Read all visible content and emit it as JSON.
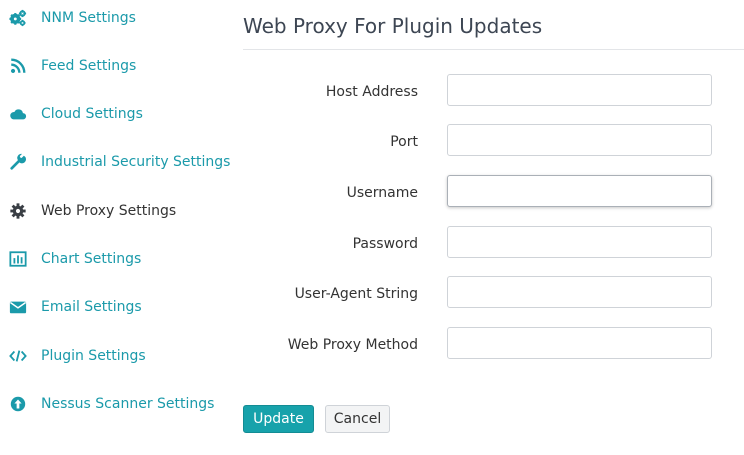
{
  "sidebar": {
    "items": [
      {
        "label": "NNM Settings",
        "icon": "gears-icon"
      },
      {
        "label": "Feed Settings",
        "icon": "rss-icon"
      },
      {
        "label": "Cloud Settings",
        "icon": "cloud-icon"
      },
      {
        "label": "Industrial Security Settings",
        "icon": "wrench-icon"
      },
      {
        "label": "Web Proxy Settings",
        "icon": "gear-icon",
        "active": true
      },
      {
        "label": "Chart Settings",
        "icon": "bar-chart-icon"
      },
      {
        "label": "Email Settings",
        "icon": "envelope-icon"
      },
      {
        "label": "Plugin Settings",
        "icon": "code-icon"
      },
      {
        "label": "Nessus Scanner Settings",
        "icon": "arrow-circle-up-icon"
      }
    ]
  },
  "main": {
    "title": "Web Proxy For Plugin Updates",
    "fields": [
      {
        "label": "Host Address",
        "value": "",
        "placeholder": ""
      },
      {
        "label": "Port",
        "value": "",
        "placeholder": ""
      },
      {
        "label": "Username",
        "value": "",
        "placeholder": "",
        "focused": true
      },
      {
        "label": "Password",
        "value": "",
        "placeholder": ""
      },
      {
        "label": "User-Agent String",
        "value": "",
        "placeholder": ""
      },
      {
        "label": "Web Proxy Method",
        "value": "",
        "placeholder": ""
      }
    ],
    "update_label": "Update",
    "cancel_label": "Cancel"
  },
  "colors": {
    "accent": "#1b9aaa",
    "primary_button": "#17a2ab",
    "text": "#333333",
    "title": "#3d4653"
  }
}
